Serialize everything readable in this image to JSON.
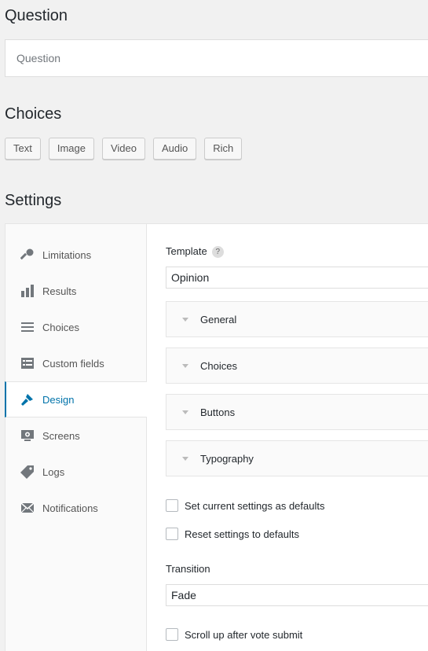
{
  "question": {
    "heading": "Question",
    "placeholder": "Question"
  },
  "choices": {
    "heading": "Choices",
    "buttons": [
      "Text",
      "Image",
      "Video",
      "Audio",
      "Rich"
    ]
  },
  "settings": {
    "heading": "Settings",
    "tabs": [
      {
        "label": "Limitations",
        "icon": "key-icon"
      },
      {
        "label": "Results",
        "icon": "bar-chart-icon"
      },
      {
        "label": "Choices",
        "icon": "list-icon"
      },
      {
        "label": "Custom fields",
        "icon": "form-fields-icon"
      },
      {
        "label": "Design",
        "icon": "paintbrush-icon",
        "active": true
      },
      {
        "label": "Screens",
        "icon": "monitor-icon"
      },
      {
        "label": "Logs",
        "icon": "tag-icon"
      },
      {
        "label": "Notifications",
        "icon": "envelope-icon"
      }
    ],
    "template": {
      "label": "Template",
      "help": "?",
      "value": "Opinion"
    },
    "sections": [
      "General",
      "Choices",
      "Buttons",
      "Typography"
    ],
    "checkboxes": {
      "set_defaults": "Set current settings as defaults",
      "reset_defaults": "Reset settings to defaults",
      "scroll_up": "Scroll up after vote submit"
    },
    "transition": {
      "label": "Transition",
      "value": "Fade"
    }
  },
  "colors": {
    "accent": "#0073aa",
    "background": "#f1f1f1"
  }
}
